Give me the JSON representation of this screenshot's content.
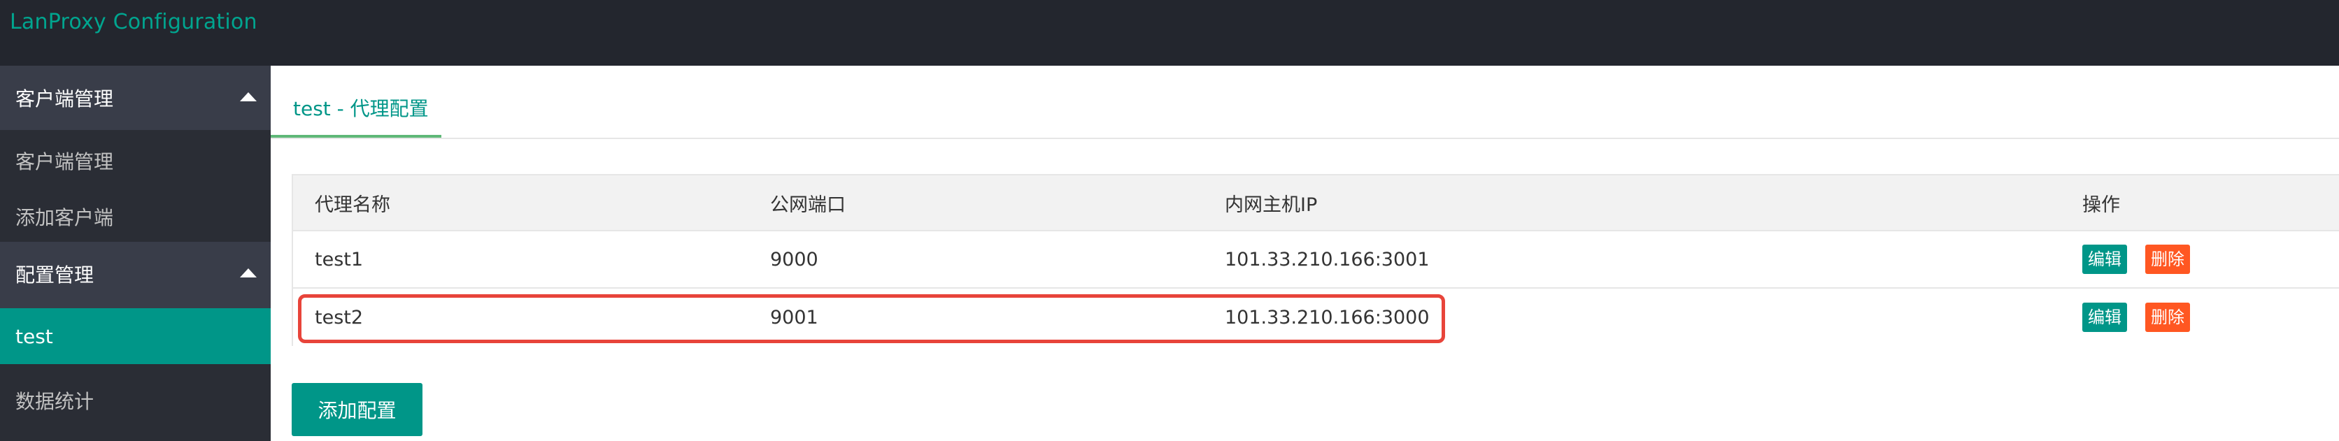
{
  "header": {
    "title": "LanProxy Configuration"
  },
  "sidebar": {
    "groups": [
      {
        "label": "客户端管理",
        "items": [
          {
            "label": "客户端管理"
          },
          {
            "label": "添加客户端"
          }
        ]
      },
      {
        "label": "配置管理",
        "items": [
          {
            "label": "test"
          },
          {
            "label": "数据统计"
          }
        ]
      }
    ],
    "active_item": "test"
  },
  "tab": {
    "label": "test - 代理配置"
  },
  "table": {
    "headers": [
      "代理名称",
      "公网端口",
      "内网主机IP",
      "操作"
    ],
    "rows": [
      {
        "name": "test1",
        "port": "9000",
        "host": "101.33.210.166:3001",
        "edit": "编辑",
        "delete": "删除"
      },
      {
        "name": "test2",
        "port": "9001",
        "host": "101.33.210.166:3000",
        "edit": "编辑",
        "delete": "删除"
      }
    ]
  },
  "actions": {
    "add_label": "添加配置"
  },
  "colors": {
    "accent": "#009688",
    "title_color": "#00a58f",
    "danger": "#ff5722",
    "highlight": "#e8443a",
    "topbar": "#23262e",
    "sidebar": "#393d49"
  }
}
